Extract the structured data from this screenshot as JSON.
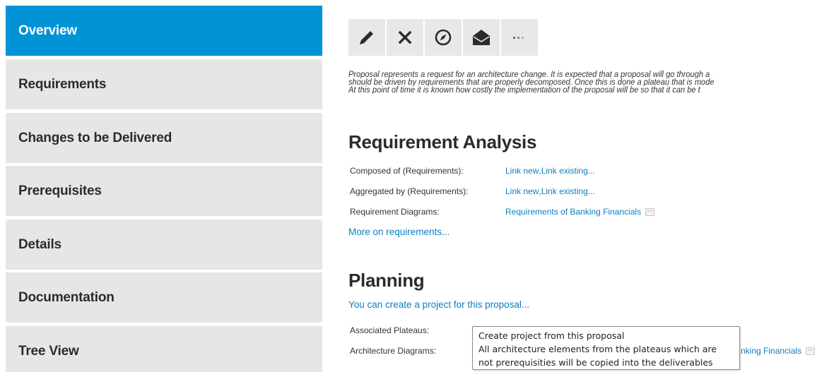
{
  "sidebar": {
    "items": [
      {
        "label": "Overview",
        "active": true
      },
      {
        "label": "Requirements"
      },
      {
        "label": "Changes to be Delivered"
      },
      {
        "label": "Prerequisites"
      },
      {
        "label": "Details"
      },
      {
        "label": "Documentation"
      },
      {
        "label": "Tree View"
      }
    ]
  },
  "toolbar": {
    "buttons": [
      {
        "icon": "pencil-icon",
        "action": "edit"
      },
      {
        "icon": "close-icon",
        "action": "delete"
      },
      {
        "icon": "compass-icon",
        "action": "navigate"
      },
      {
        "icon": "envelope-icon",
        "action": "email"
      },
      {
        "icon": "more-icon",
        "action": "more"
      }
    ]
  },
  "intro": {
    "line1": "Proposal represents a request for an architecture change. It is expected that a proposal will go through a",
    "line2": "should be driven by requirements that are properly decomposed. Once this is done a plateau that is mode",
    "line3": "At this point of time it is known how costly the implementation of the proposal will be so that it can be t"
  },
  "requirement_analysis": {
    "title": "Requirement Analysis",
    "rows": [
      {
        "label": "Composed of (Requirements):",
        "link1": "Link new",
        "sep": ", ",
        "link2": "Link existing..."
      },
      {
        "label": "Aggregated by (Requirements):",
        "link1": "Link new",
        "sep": ", ",
        "link2": "Link existing..."
      },
      {
        "label": "Requirement Diagrams:",
        "link1": "Requirements of Banking Financials",
        "more": "···"
      }
    ],
    "more_link": "More on requirements..."
  },
  "planning": {
    "title": "Planning",
    "create_link": "You can create a project for this proposal...",
    "rows": [
      {
        "label": "Associated Plateaus:"
      },
      {
        "label": "Architecture Diagrams:",
        "link_partial": "nking Financials",
        "more": "···"
      }
    ]
  },
  "tooltip": {
    "line1": "Create project from this proposal",
    "line2": "All architecture elements from the plateaus which are",
    "line3": "not prerequisities will be copied into the deliverables"
  },
  "colors": {
    "active": "#0093d6",
    "nav_bg": "#e5e7e7",
    "link": "#0a7fc2",
    "toolbar_bg": "#e7e9e9"
  }
}
